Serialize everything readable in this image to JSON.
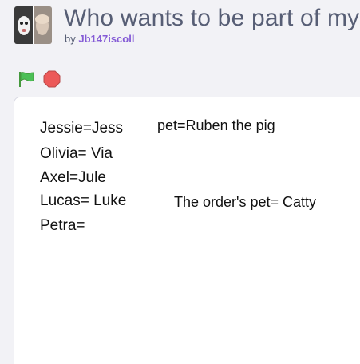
{
  "project": {
    "title": "Who wants to be part of my n",
    "by_label": "by",
    "author": "Jb147iscoll"
  },
  "controls": {
    "green_flag_icon": "green-flag-icon",
    "stop_icon": "stop-sign-icon"
  },
  "stage": {
    "lines": [
      "Jessie=Jess",
      "Olivia= Via",
      "Axel=Jule",
      "Lucas= Luke",
      "Petra="
    ],
    "pet_line": "pet=Ruben the pig",
    "order_pet_line": "The order's pet= Catty"
  },
  "colors": {
    "title": "#575e75",
    "author": "#855cd6",
    "flag": "#4cbf56",
    "stop": "#ec5959"
  }
}
